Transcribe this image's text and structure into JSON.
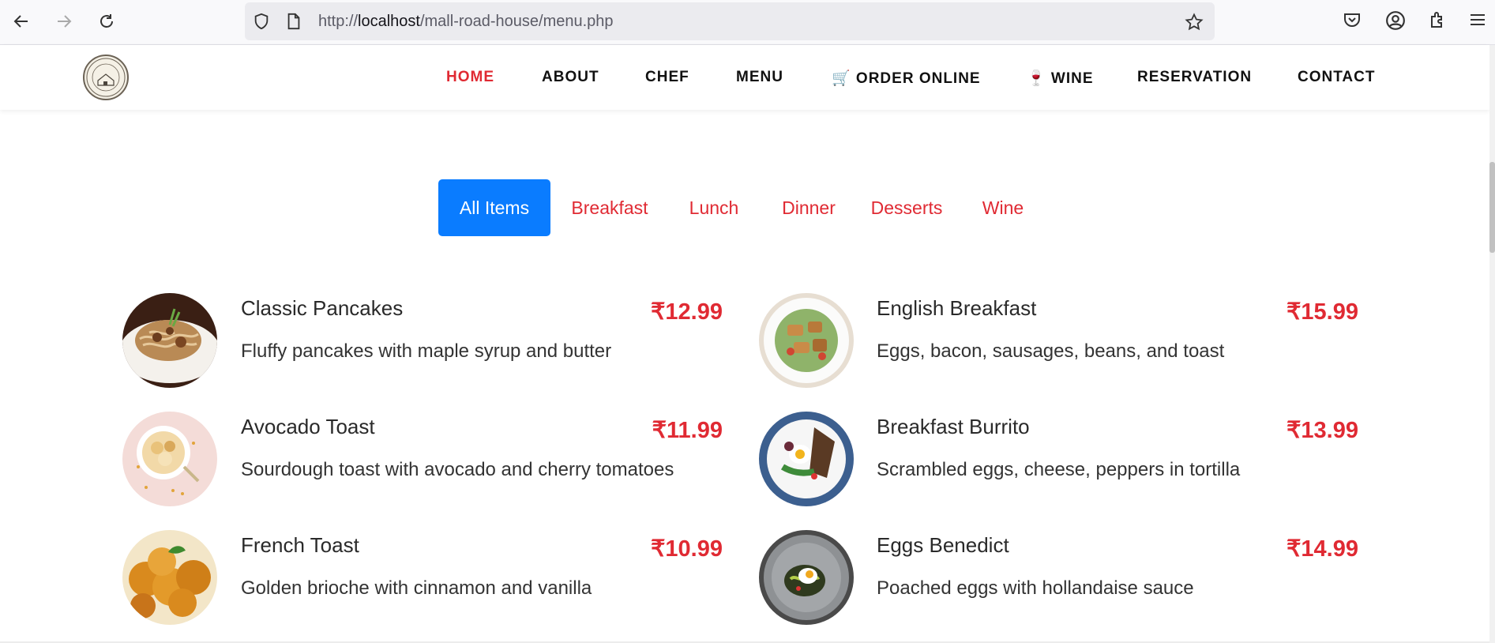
{
  "browser": {
    "url_prefix": "http://",
    "url_host": "localhost",
    "url_path": "/mall-road-house/menu.php",
    "icons": [
      "back-arrow-icon",
      "forward-arrow-icon",
      "reload-icon",
      "shield-icon",
      "page-icon",
      "star-icon",
      "pocket-icon",
      "account-icon",
      "extensions-icon",
      "hamburger-menu-icon"
    ]
  },
  "header": {
    "logo_text_top": "MALLROAD HOUSE",
    "logo_text_bottom": "BISHOPBRIGGS",
    "nav": [
      {
        "label": "HOME",
        "active": true
      },
      {
        "label": "ABOUT",
        "active": false
      },
      {
        "label": "CHEF",
        "active": false
      },
      {
        "label": "MENU",
        "active": false
      },
      {
        "label": "🛒 ORDER ONLINE",
        "active": false
      },
      {
        "label": "🍷 WINE",
        "active": false
      },
      {
        "label": "RESERVATION",
        "active": false
      },
      {
        "label": "CONTACT",
        "active": false
      }
    ]
  },
  "filters": [
    {
      "label": "All Items",
      "active": true
    },
    {
      "label": "Breakfast",
      "active": false
    },
    {
      "label": "Lunch",
      "active": false
    },
    {
      "label": "Dinner",
      "active": false
    },
    {
      "label": "Desserts",
      "active": false
    },
    {
      "label": "Wine",
      "active": false
    }
  ],
  "menu_items": [
    {
      "name": "Classic Pancakes",
      "price": "₹12.99",
      "description": "Fluffy pancakes with maple syrup and butter"
    },
    {
      "name": "English Breakfast",
      "price": "₹15.99",
      "description": "Eggs, bacon, sausages, beans, and toast"
    },
    {
      "name": "Avocado Toast",
      "price": "₹11.99",
      "description": "Sourdough toast with avocado and cherry tomatoes"
    },
    {
      "name": "Breakfast Burrito",
      "price": "₹13.99",
      "description": "Scrambled eggs, cheese, peppers in tortilla"
    },
    {
      "name": "French Toast",
      "price": "₹10.99",
      "description": "Golden brioche with cinnamon and vanilla"
    },
    {
      "name": "Eggs Benedict",
      "price": "₹14.99",
      "description": "Poached eggs with hollandaise sauce"
    }
  ],
  "colors": {
    "accent_red": "#e02a33",
    "active_tab_blue": "#0a7cff"
  }
}
